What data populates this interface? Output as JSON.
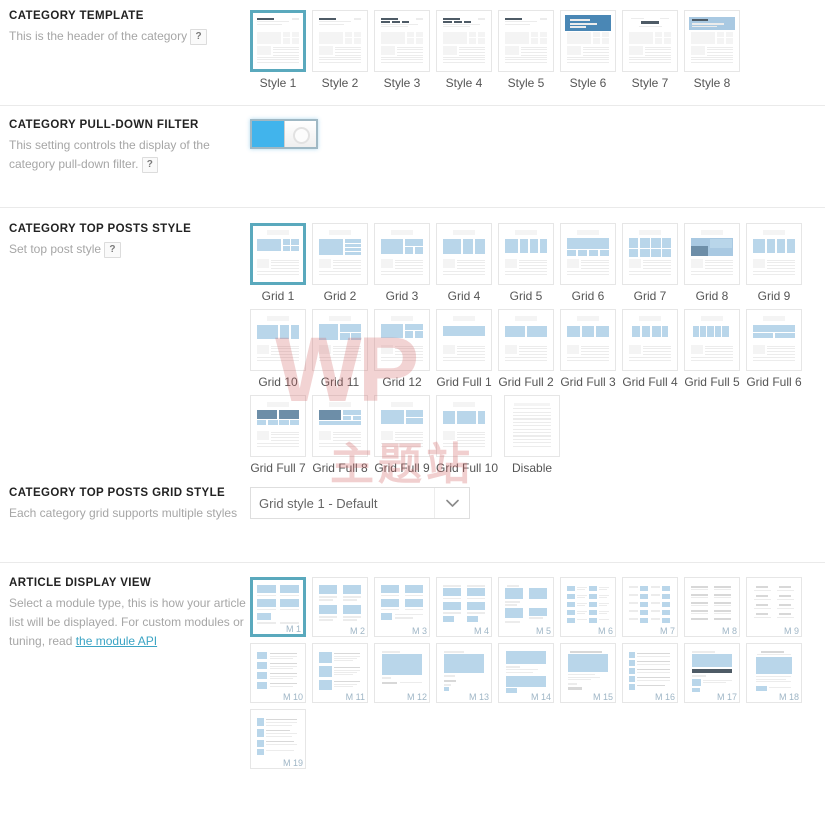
{
  "sections": [
    {
      "id": "category-template",
      "title": "CATEGORY TEMPLATE",
      "desc_before": "This is the header of the category",
      "help": "?",
      "options": [
        {
          "label": "Style 1",
          "selected": true
        },
        {
          "label": "Style 2",
          "selected": false
        },
        {
          "label": "Style 3",
          "selected": false
        },
        {
          "label": "Style 4",
          "selected": false
        },
        {
          "label": "Style 5",
          "selected": false
        },
        {
          "label": "Style 6",
          "selected": false
        },
        {
          "label": "Style 7",
          "selected": false
        },
        {
          "label": "Style 8",
          "selected": false
        }
      ]
    },
    {
      "id": "category-pull-down-filter",
      "title": "CATEGORY PULL-DOWN FILTER",
      "desc_before": "This setting controls the display of the category pull-down filter.",
      "help": "?",
      "toggle": {
        "state": "on"
      }
    },
    {
      "id": "category-top-posts-style",
      "title": "CATEGORY TOP POSTS STYLE",
      "desc_before": "Set top post style",
      "help": "?",
      "options": [
        {
          "label": "Grid 1",
          "selected": true
        },
        {
          "label": "Grid 2",
          "selected": false
        },
        {
          "label": "Grid 3",
          "selected": false
        },
        {
          "label": "Grid 4",
          "selected": false
        },
        {
          "label": "Grid 5",
          "selected": false
        },
        {
          "label": "Grid 6",
          "selected": false
        },
        {
          "label": "Grid 7",
          "selected": false
        },
        {
          "label": "Grid 8",
          "selected": false
        },
        {
          "label": "Grid 9",
          "selected": false
        },
        {
          "label": "Grid 10",
          "selected": false
        },
        {
          "label": "Grid 11",
          "selected": false
        },
        {
          "label": "Grid 12",
          "selected": false
        },
        {
          "label": "Grid Full 1",
          "selected": false
        },
        {
          "label": "Grid Full 2",
          "selected": false
        },
        {
          "label": "Grid Full 3",
          "selected": false
        },
        {
          "label": "Grid Full 4",
          "selected": false
        },
        {
          "label": "Grid Full 5",
          "selected": false
        },
        {
          "label": "Grid Full 6",
          "selected": false
        },
        {
          "label": "Grid Full 7",
          "selected": false
        },
        {
          "label": "Grid Full 8",
          "selected": false
        },
        {
          "label": "Grid Full 9",
          "selected": false
        },
        {
          "label": "Grid Full 10",
          "selected": false
        },
        {
          "label": "Disable",
          "selected": false
        }
      ]
    },
    {
      "id": "category-top-posts-grid-style",
      "title": "CATEGORY TOP POSTS GRID STYLE",
      "desc_before": "Each category grid supports multiple styles",
      "select": {
        "value": "Grid style 1 - Default",
        "arrow_icon": "chevron-down-icon"
      }
    },
    {
      "id": "article-display-view",
      "title": "ARTICLE DISPLAY VIEW",
      "desc_before": "Select a module type, this is how your article list will be displayed. For custom modules or tuning, read ",
      "link_text": "the module API",
      "options": [
        {
          "label": "M 1",
          "selected": true
        },
        {
          "label": "M 2",
          "selected": false
        },
        {
          "label": "M 3",
          "selected": false
        },
        {
          "label": "M 4",
          "selected": false
        },
        {
          "label": "M 5",
          "selected": false
        },
        {
          "label": "M 6",
          "selected": false
        },
        {
          "label": "M 7",
          "selected": false
        },
        {
          "label": "M 8",
          "selected": false
        },
        {
          "label": "M 9",
          "selected": false
        },
        {
          "label": "M 10",
          "selected": false
        },
        {
          "label": "M 11",
          "selected": false
        },
        {
          "label": "M 12",
          "selected": false
        },
        {
          "label": "M 13",
          "selected": false
        },
        {
          "label": "M 14",
          "selected": false
        },
        {
          "label": "M 15",
          "selected": false
        },
        {
          "label": "M 16",
          "selected": false
        },
        {
          "label": "M 17",
          "selected": false
        },
        {
          "label": "M 18",
          "selected": false
        },
        {
          "label": "M 19",
          "selected": false
        }
      ]
    }
  ],
  "watermark": {
    "primary": "WP",
    "secondary": "主题站"
  },
  "colors": {
    "accent": "#5aa9bd",
    "toggle_on": "#41b4ec",
    "link": "#3ba4c4",
    "thumb_blue": "#b9d6ea",
    "watermark": "#d16060"
  }
}
